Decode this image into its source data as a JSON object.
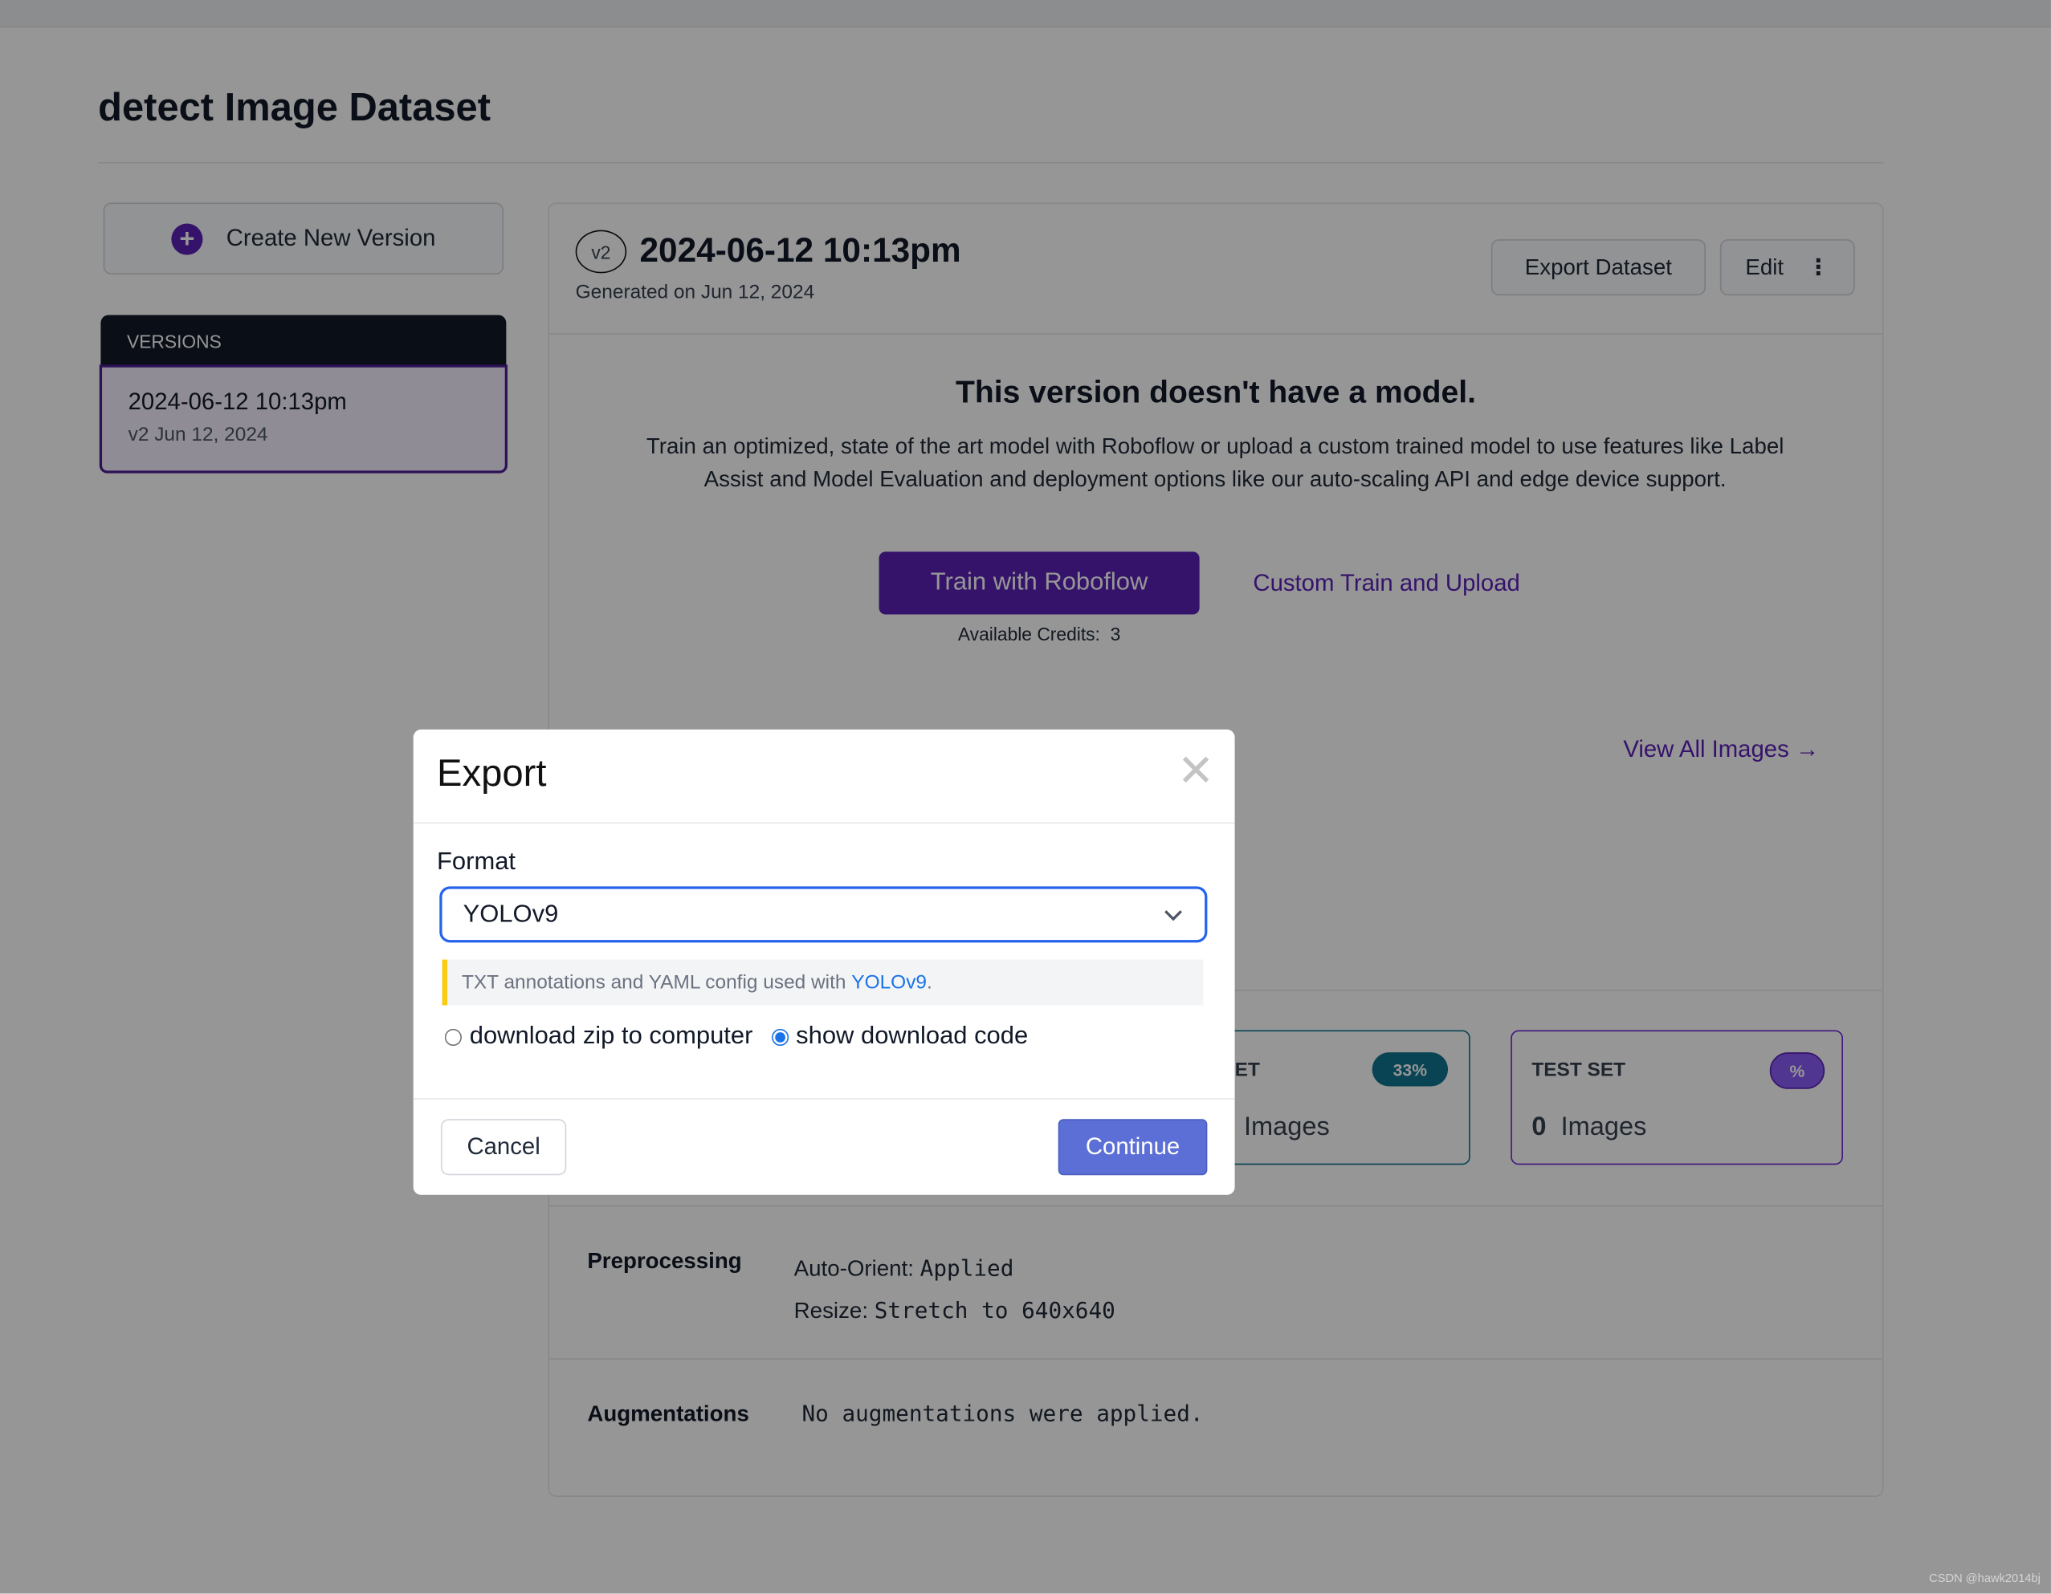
{
  "page": {
    "title": "detect Image Dataset",
    "watermark": "CSDN @hawk2014bj"
  },
  "sidebar": {
    "create_button": "Create New Version",
    "versions_header": "VERSIONS",
    "versions": [
      {
        "name": "2024-06-12 10:13pm",
        "meta": "v2 Jun 12, 2024"
      }
    ]
  },
  "version": {
    "badge": "v2",
    "title": "2024-06-12 10:13pm",
    "generated": "Generated on Jun 12, 2024",
    "export_button": "Export Dataset",
    "edit_button": "Edit"
  },
  "model": {
    "heading": "This version doesn't have a model.",
    "description": "Train an optimized, state of the art model with Roboflow or upload a custom trained model to use features like Label Assist and Model Evaluation and deployment options like our auto-scaling API and edge device support.",
    "train_button": "Train with Roboflow",
    "custom_link": "Custom Train and Upload",
    "credits_label": "Available Credits:",
    "credits_value": "3"
  },
  "images": {
    "view_all": "View All Images"
  },
  "splits": [
    {
      "label": "VALID SET",
      "percent": "33%",
      "images_label": "Images",
      "color": "#0e7490"
    },
    {
      "label": "TEST SET",
      "percent": "%",
      "count": "0",
      "images_label": "Images",
      "color": "#6d28d9"
    }
  ],
  "preprocessing": {
    "label": "Preprocessing",
    "items": [
      {
        "key": "Auto-Orient:",
        "value": "Applied"
      },
      {
        "key": "Resize:",
        "value": "Stretch to 640x640"
      }
    ]
  },
  "augmentations": {
    "label": "Augmentations",
    "value": "No augmentations were applied."
  },
  "modal": {
    "title": "Export",
    "format_label": "Format",
    "format_value": "YOLOv9",
    "info_text": "TXT annotations and YAML config used with ",
    "info_link": "YOLOv9",
    "info_end": ".",
    "options": [
      {
        "label": "download zip to computer",
        "checked": false
      },
      {
        "label": "show download code",
        "checked": true
      }
    ],
    "cancel": "Cancel",
    "continue": "Continue"
  },
  "colors": {
    "accent": "#5b21b6",
    "select_border": "#2563eb",
    "continue_bg": "#5c6fd6",
    "info_bar": "#facc15",
    "link_blue": "#1a73e8"
  }
}
